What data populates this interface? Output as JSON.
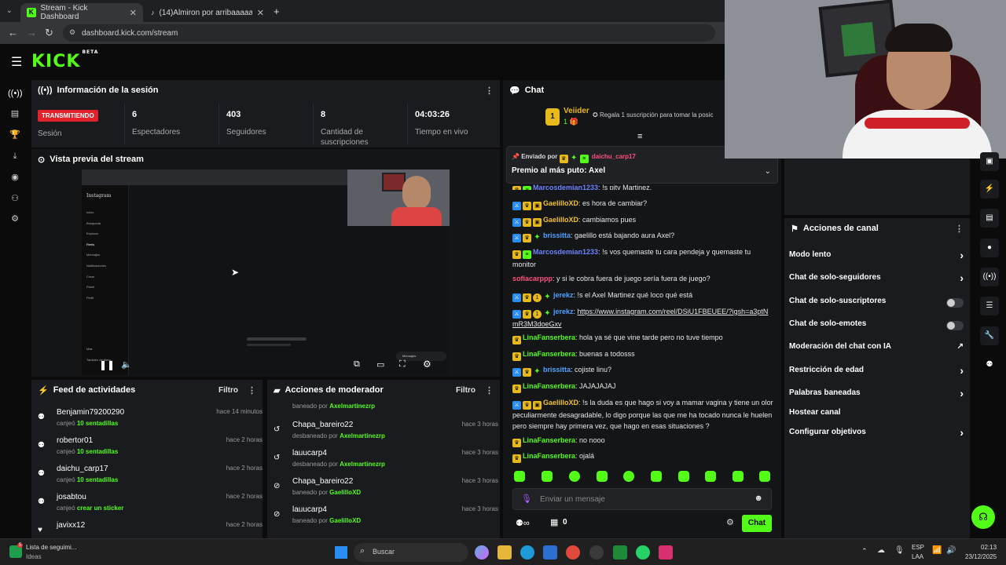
{
  "browser": {
    "tabs": [
      {
        "title": "Stream - Kick Dashboard",
        "active": true
      },
      {
        "title": "(14)Almiron por arribaaaaaaaa",
        "active": false
      }
    ],
    "url": "dashboard.kick.com/stream"
  },
  "header": {
    "logo": "KICK",
    "logo_badge": "BETA"
  },
  "session": {
    "title": "Información de la sesión",
    "status_badge": "TRANSMITIENDO",
    "status_label": "Sesión",
    "stats": [
      {
        "value": "6",
        "label": "Espectadores"
      },
      {
        "value": "403",
        "label": "Seguidores"
      },
      {
        "value": "8",
        "label": "Cantidad de suscripciones"
      },
      {
        "value": "04:03:26",
        "label": "Tiempo en vivo"
      }
    ]
  },
  "preview": {
    "title": "Vista previa del stream",
    "sidebar_title": "Instagram",
    "sidebar_items": [
      "Inicio",
      "Búsqueda",
      "Explorar",
      "Reels",
      "Mensajes",
      "Notificaciones",
      "Crear",
      "Panel",
      "Perfil",
      "Más",
      "También de Meta"
    ],
    "toast": "Mensajes"
  },
  "feed": {
    "title": "Feed de actividades",
    "filter": "Filtro",
    "items": [
      {
        "name": "Benjamin79200290",
        "verb": "canjeó",
        "item": "10 sentadillas",
        "time": "hace 14 minutos"
      },
      {
        "name": "robertor01",
        "verb": "canjeó",
        "item": "10 sentadillas",
        "time": "hace 2 horas"
      },
      {
        "name": "daichu_carp17",
        "verb": "canjeó",
        "item": "10 sentadillas",
        "time": "hace 2 horas"
      },
      {
        "name": "josabtou",
        "verb": "canjeó",
        "item": "crear un sticker",
        "time": "hace 2 horas"
      },
      {
        "name": "javixx12",
        "verb": "",
        "item": "",
        "time": "hace 2 horas"
      }
    ]
  },
  "modactions": {
    "title": "Acciones de moderador",
    "filter": "Filtro",
    "first_partial": {
      "verb": "baneado por",
      "by": "Axelmartinezrp"
    },
    "items": [
      {
        "name": "Chapa_bareiro22",
        "verb": "desbaneado por",
        "by": "Axelmartinezrp",
        "time": "hace 3 horas",
        "icon": "unban"
      },
      {
        "name": "lauucarp4",
        "verb": "desbaneado por",
        "by": "Axelmartinezrp",
        "time": "hace 3 horas",
        "icon": "unban"
      },
      {
        "name": "Chapa_bareiro22",
        "verb": "baneado por",
        "by": "GaelilloXD",
        "time": "hace 3 horas",
        "icon": "ban"
      },
      {
        "name": "lauucarp4",
        "verb": "baneado por",
        "by": "GaelilloXD",
        "time": "hace 3 horas",
        "icon": "ban"
      }
    ]
  },
  "chat": {
    "title": "Chat",
    "top_gifter": {
      "name": "Veiider",
      "count": "1",
      "rank": "1"
    },
    "gift_promo": "Regala 1 suscripción para tomar la posic",
    "pinned": {
      "sent_by_label": "Enviado por",
      "sender": "daichu_carp17",
      "text": "Premio al más puto: Axel"
    },
    "messages": [
      {
        "user": "Marcosdemian1233",
        "color": "#6f83ff",
        "badges": [
          "crown",
          "green"
        ],
        "text": "!s pity Martinez,"
      },
      {
        "user": "GaelilloXD",
        "color": "#f2c230",
        "badges": [
          "mod",
          "crown",
          "gift"
        ],
        "text": "es hora de cambiar?"
      },
      {
        "user": "GaelilloXD",
        "color": "#f2c230",
        "badges": [
          "mod",
          "crown",
          "gift"
        ],
        "text": "cambiamos pues"
      },
      {
        "user": "brissitta",
        "color": "#4aa3ff",
        "badges": [
          "mod",
          "crown",
          "spark"
        ],
        "text": "gaelillo está bajando aura Axel?"
      },
      {
        "user": "Marcosdemian1233",
        "color": "#6f83ff",
        "badges": [
          "crown",
          "green"
        ],
        "text": "!s vos quemaste tu cara pendeja y quemaste tu monitor"
      },
      {
        "user": "sofiacarppp",
        "color": "#ff4f7b",
        "badges": [],
        "text": "y si le cobra fuera de juego sería fuera de juego?"
      },
      {
        "user": "jerekz",
        "color": "#4aa3ff",
        "badges": [
          "mod",
          "crown",
          "one",
          "spark"
        ],
        "text": "!s el Axel Martinez qué loco qué está"
      },
      {
        "user": "jerekz",
        "color": "#4aa3ff",
        "badges": [
          "mod",
          "crown",
          "one",
          "spark"
        ],
        "text": "https://www.instagram.com/reel/DSiU1FBEUEE/?igsh=a3ptNmR3M3doeGxv"
      },
      {
        "user": "LinaFanserbera",
        "color": "#53fc18",
        "badges": [
          "crown"
        ],
        "text": "hola ya sé que vine tarde pero no tuve tiempo"
      },
      {
        "user": "LinaFanserbera",
        "color": "#53fc18",
        "badges": [
          "crown"
        ],
        "text": "buenas a todosss"
      },
      {
        "user": "brissitta",
        "color": "#4aa3ff",
        "badges": [
          "mod",
          "crown",
          "spark"
        ],
        "text": "cojiste linu?"
      },
      {
        "user": "LinaFanserbera",
        "color": "#53fc18",
        "badges": [
          "crown"
        ],
        "text": "JAJAJAJAJ"
      },
      {
        "user": "GaelilloXD",
        "color": "#f2c230",
        "badges": [
          "mod",
          "crown",
          "gift"
        ],
        "text": "!s la duda es que hago si voy a mamar vagina y tiene un olor peculiarmente desagradable, lo digo porque las que me ha tocado nunca le huelen pero siempre hay primera vez, que hago en esas situaciones ?"
      },
      {
        "user": "LinaFanserbera",
        "color": "#53fc18",
        "badges": [
          "crown"
        ],
        "text": "no nooo"
      },
      {
        "user": "LinaFanserbera",
        "color": "#53fc18",
        "badges": [
          "crown"
        ],
        "text": "ojalá"
      }
    ],
    "input_placeholder": "Enviar un mensaje",
    "points": "0",
    "send_label": "Chat"
  },
  "channel_actions": {
    "title": "Acciones de canal",
    "items": [
      {
        "label": "Modo lento",
        "control": "chevron"
      },
      {
        "label": "Chat de solo-seguidores",
        "control": "chevron"
      },
      {
        "label": "Chat de solo-suscriptores",
        "control": "toggle"
      },
      {
        "label": "Chat de solo-emotes",
        "control": "toggle"
      },
      {
        "label": "Moderación del chat con IA",
        "control": "external"
      },
      {
        "label": "Restricción de edad",
        "control": "chevron"
      },
      {
        "label": "Palabras baneadas",
        "control": "chevron"
      },
      {
        "label": "Hostear canal",
        "control": "none"
      },
      {
        "label": "Configurar objetivos",
        "control": "chevron"
      }
    ]
  },
  "taskbar": {
    "widget_title": "Lista de seguimi...",
    "widget_sub": "Ideas",
    "widget_badge": "5",
    "search": "Buscar",
    "lang": "ESP",
    "lang_sub": "LAA",
    "time": "02:13",
    "date": "23/12/2025"
  },
  "colors": {
    "accent": "#53fc18",
    "live": "#e3212b",
    "panel": "#191b1f"
  }
}
